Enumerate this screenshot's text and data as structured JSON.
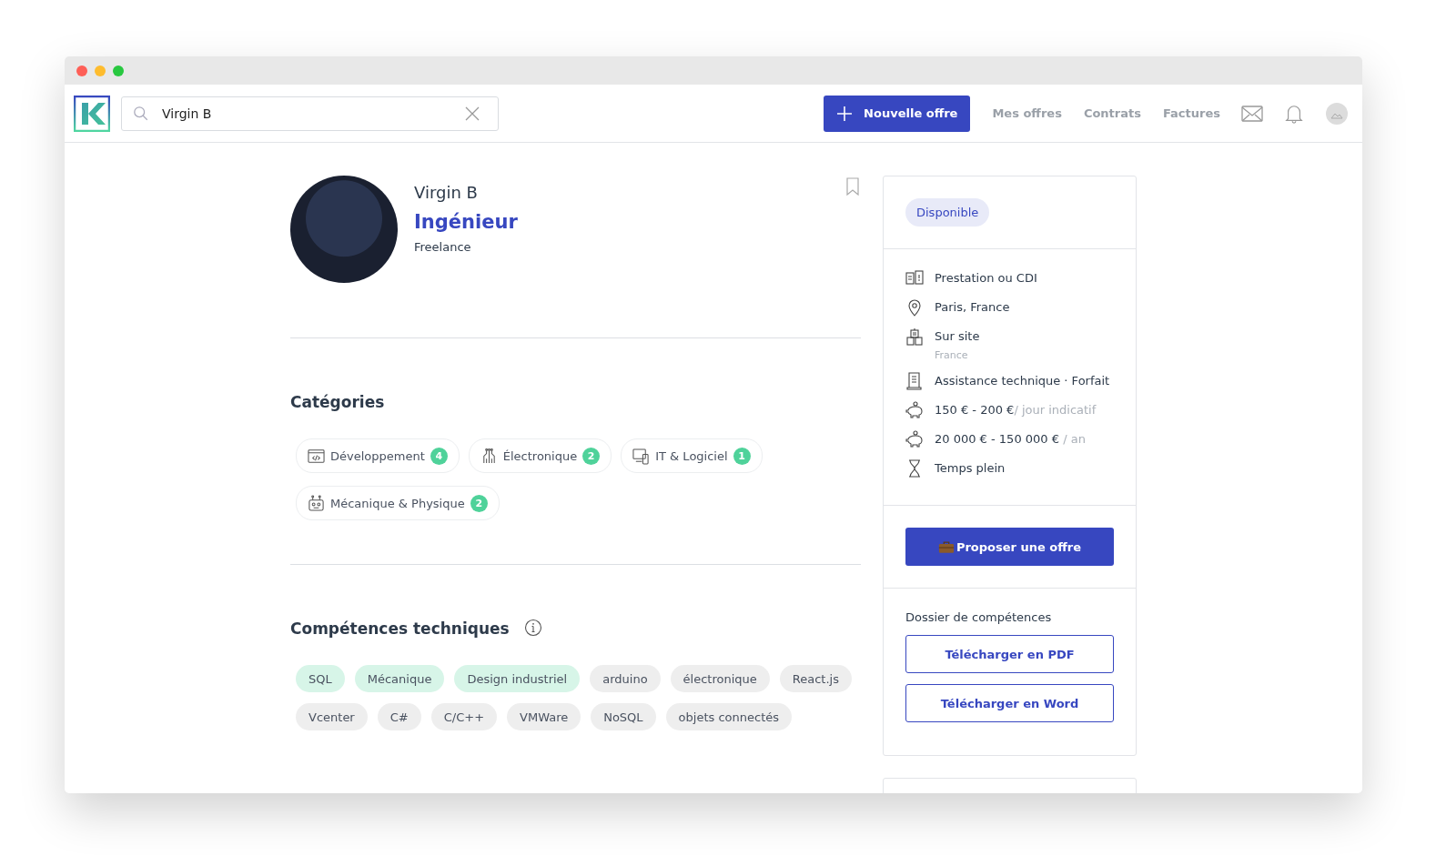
{
  "search": {
    "value": "Virgin B"
  },
  "nav": {
    "new_offer": "Nouvelle offre",
    "links": [
      "Mes offres",
      "Contrats",
      "Factures"
    ]
  },
  "profile": {
    "name": "Virgin B",
    "title": "Ingénieur",
    "type": "Freelance",
    "bookmarked": false
  },
  "categories": {
    "heading": "Catégories",
    "items": [
      {
        "label": "Développement",
        "count": "4",
        "kind": "code"
      },
      {
        "label": "Électronique",
        "count": "2",
        "kind": "circuit"
      },
      {
        "label": "IT & Logiciel",
        "count": "1",
        "kind": "devices"
      },
      {
        "label": "Mécanique & Physique",
        "count": "2",
        "kind": "robot"
      }
    ]
  },
  "skills": {
    "heading": "Compétences techniques",
    "items": [
      {
        "label": "SQL",
        "highlighted": true
      },
      {
        "label": "Mécanique",
        "highlighted": true
      },
      {
        "label": "Design industriel",
        "highlighted": true
      },
      {
        "label": "arduino",
        "highlighted": false
      },
      {
        "label": "électronique",
        "highlighted": false
      },
      {
        "label": "React.js",
        "highlighted": false
      },
      {
        "label": "Vcenter",
        "highlighted": false
      },
      {
        "label": "C#",
        "highlighted": false
      },
      {
        "label": "C/C++",
        "highlighted": false
      },
      {
        "label": "VMWare",
        "highlighted": false
      },
      {
        "label": "NoSQL",
        "highlighted": false
      },
      {
        "label": "objets connectés",
        "highlighted": false
      }
    ]
  },
  "sidebar": {
    "status": "Disponible",
    "details": [
      {
        "kind": "contract",
        "text": "Prestation ou CDI"
      },
      {
        "kind": "location",
        "text": "Paris, France"
      },
      {
        "kind": "building",
        "text": "Sur site",
        "sub": "France"
      },
      {
        "kind": "document",
        "text": "Assistance technique · Forfait"
      },
      {
        "kind": "money",
        "text": "150 € - 200 €",
        "suffix": "/ jour indicatif"
      },
      {
        "kind": "money",
        "text": "20 000 € - 150 000 €",
        "suffix": " / an"
      },
      {
        "kind": "duration",
        "text": "Temps plein"
      }
    ],
    "propose": "Proposer une offre",
    "dossier": {
      "label": "Dossier de compétences",
      "buttons": [
        "Télécharger en PDF",
        "Télécharger en Word"
      ]
    }
  }
}
